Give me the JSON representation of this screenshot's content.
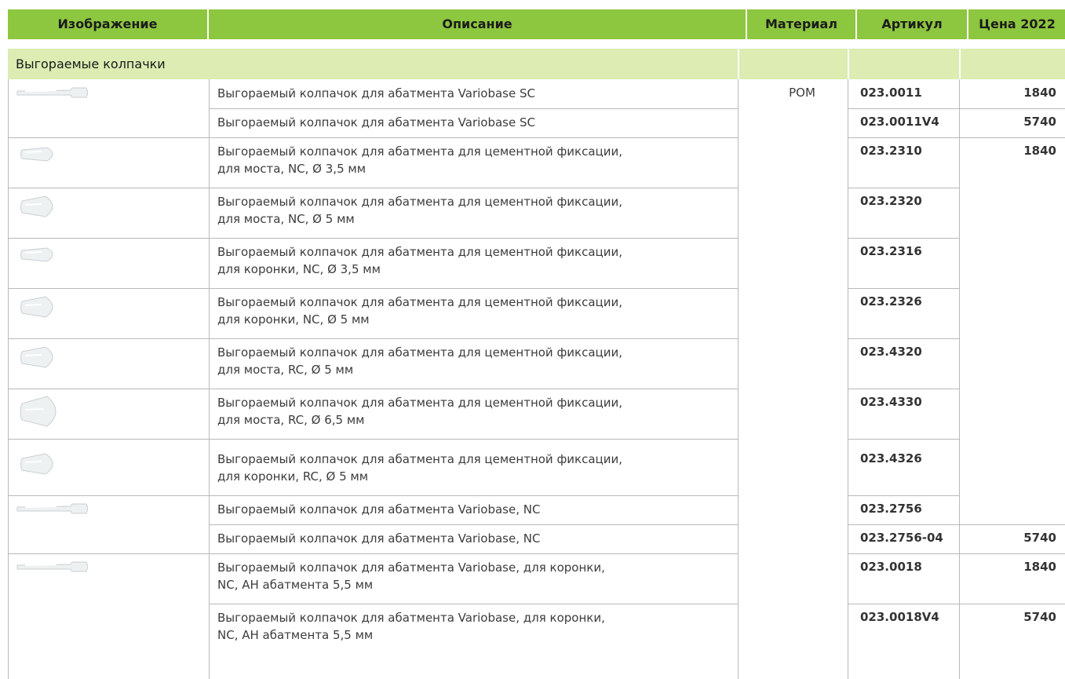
{
  "headers": {
    "image": "Изображение",
    "description": "Описание",
    "material": "Материал",
    "article": "Артикул",
    "price": "Цена 2022"
  },
  "section_title": "Выгораемые колпачки",
  "material": "POM",
  "rows": [
    {
      "line1": "Выгораемый колпачок для абатмента Variobase SC",
      "line2": "",
      "article": "023.0011",
      "price": "1840",
      "image": "long-cap-thumbnail"
    },
    {
      "line1": "Выгораемый колпачок для абатмента Variobase SC",
      "line2": "",
      "article": "023.0011V4",
      "price": "5740",
      "image": ""
    },
    {
      "line1": "Выгораемый колпачок для абатмента для цементной фиксации,",
      "line2": "для моста, NC, Ø 3,5 мм",
      "article": "023.2310",
      "price": "1840",
      "image": "small-cap-thumbnail"
    },
    {
      "line1": "Выгораемый колпачок для абатмента для цементной фиксации,",
      "line2": "для моста, NC, Ø 5 мм",
      "article": "023.2320",
      "price": "",
      "image": "medium-cap-thumbnail"
    },
    {
      "line1": "Выгораемый колпачок для абатмента для цементной фиксации,",
      "line2": "для коронки, NC, Ø 3,5 мм",
      "article": "023.2316",
      "price": "",
      "image": "small-cap-thumbnail"
    },
    {
      "line1": "Выгораемый колпачок для абатмента для цементной фиксации,",
      "line2": "для коронки, NC, Ø 5 мм",
      "article": "023.2326",
      "price": "",
      "image": "medium-cap-thumbnail"
    },
    {
      "line1": "Выгораемый колпачок для абатмента для цементной фиксации,",
      "line2": "для моста, RC, Ø 5 мм",
      "article": "023.4320",
      "price": "",
      "image": "medium-cap-thumbnail"
    },
    {
      "line1": "Выгораемый колпачок для абатмента для цементной фиксации,",
      "line2": "для моста, RC, Ø 6,5 мм",
      "article": "023.4330",
      "price": "",
      "image": "large-cap-thumbnail"
    },
    {
      "line1": "Выгораемый колпачок для абатмента для цементной фиксации,",
      "line2": "для коронки, RC, Ø 5 мм",
      "article": "023.4326",
      "price": "",
      "image": "medium-cap-thumbnail"
    },
    {
      "line1": "Выгораемый колпачок для абатмента Variobase, NC",
      "line2": "",
      "article": "023.2756",
      "price": "",
      "image": "long-cap-thumbnail"
    },
    {
      "line1": "Выгораемый колпачок для абатмента Variobase, NC",
      "line2": "",
      "article": "023.2756-04",
      "price": "5740",
      "image": ""
    },
    {
      "line1": "Выгораемый колпачок для абатмента Variobase, для коронки,",
      "line2": "NC, AH абатмента 5,5 мм",
      "article": "023.0018",
      "price": "1840",
      "image": "long-cap-thumbnail"
    },
    {
      "line1": "Выгораемый колпачок для абатмента Variobase, для коронки,",
      "line2": "NC, AH абатмента 5,5 мм",
      "article": "023.0018V4",
      "price": "5740",
      "image": ""
    }
  ],
  "colors": {
    "header_bg": "#8dc63f",
    "section_bg": "#dcecb2",
    "grid_line": "#b9b9b9"
  }
}
